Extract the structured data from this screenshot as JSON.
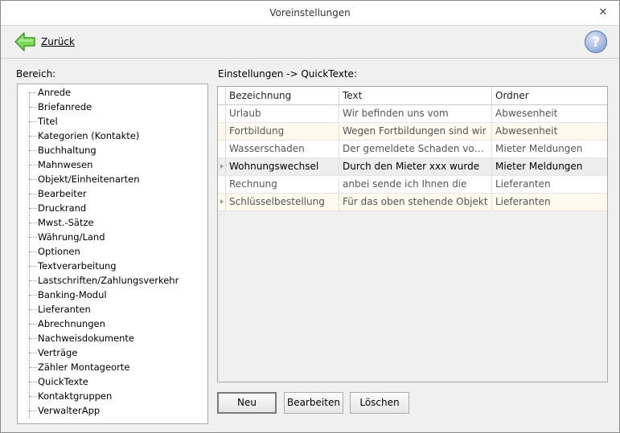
{
  "window": {
    "title": "Voreinstellungen"
  },
  "nav": {
    "back_label": "Zurück"
  },
  "left": {
    "label": "Bereich:",
    "items": [
      "Anrede",
      "Briefanrede",
      "Titel",
      "Kategorien (Kontakte)",
      "Buchhaltung",
      "Mahnwesen",
      "Objekt/Einheitenarten",
      "Bearbeiter",
      "Druckrand",
      "Mwst.-Sätze",
      "Währung/Land",
      "Optionen",
      "Textverarbeitung",
      "Lastschriften/Zahlungsverkehr",
      "Banking-Modul",
      "Lieferanten",
      "Abrechnungen",
      "Nachweisdokumente",
      "Verträge",
      "Zähler Montageorte",
      "QuickTexte",
      "Kontaktgruppen",
      "VerwalterApp"
    ]
  },
  "right": {
    "label": "Einstellungen -> QuickTexte:",
    "columns": [
      "Bezeichnung",
      "Text",
      "Ordner"
    ],
    "rows": [
      {
        "bezeichnung": "Urlaub",
        "text": "Wir befinden uns vom",
        "ordner": "Abwesenheit"
      },
      {
        "bezeichnung": "Fortbildung",
        "text": "Wegen Fortbildungen sind wir",
        "ordner": "Abwesenheit"
      },
      {
        "bezeichnung": "Wasserschaden",
        "text": "Der gemeldete Schaden vom ...",
        "ordner": "Mieter Meldungen"
      },
      {
        "bezeichnung": "Wohnungswechsel",
        "text": "Durch den Mieter xxx wurde",
        "ordner": "Mieter Meldungen"
      },
      {
        "bezeichnung": "Rechnung",
        "text": "anbei sende ich Ihnen die",
        "ordner": "Lieferanten"
      },
      {
        "bezeichnung": "Schlüsselbestellung",
        "text": "Für das oben stehende Objekt",
        "ordner": "Lieferanten"
      }
    ]
  },
  "buttons": {
    "new": "Neu",
    "edit": "Bearbeiten",
    "delete": "Löschen"
  },
  "icons": {
    "back": "arrow-left-icon",
    "help": "help-icon",
    "close": "close-icon"
  },
  "colors": {
    "back_arrow": "#6cc24a",
    "help_icon": "#7a9bd0",
    "row_alt": "#fdf9ee"
  }
}
